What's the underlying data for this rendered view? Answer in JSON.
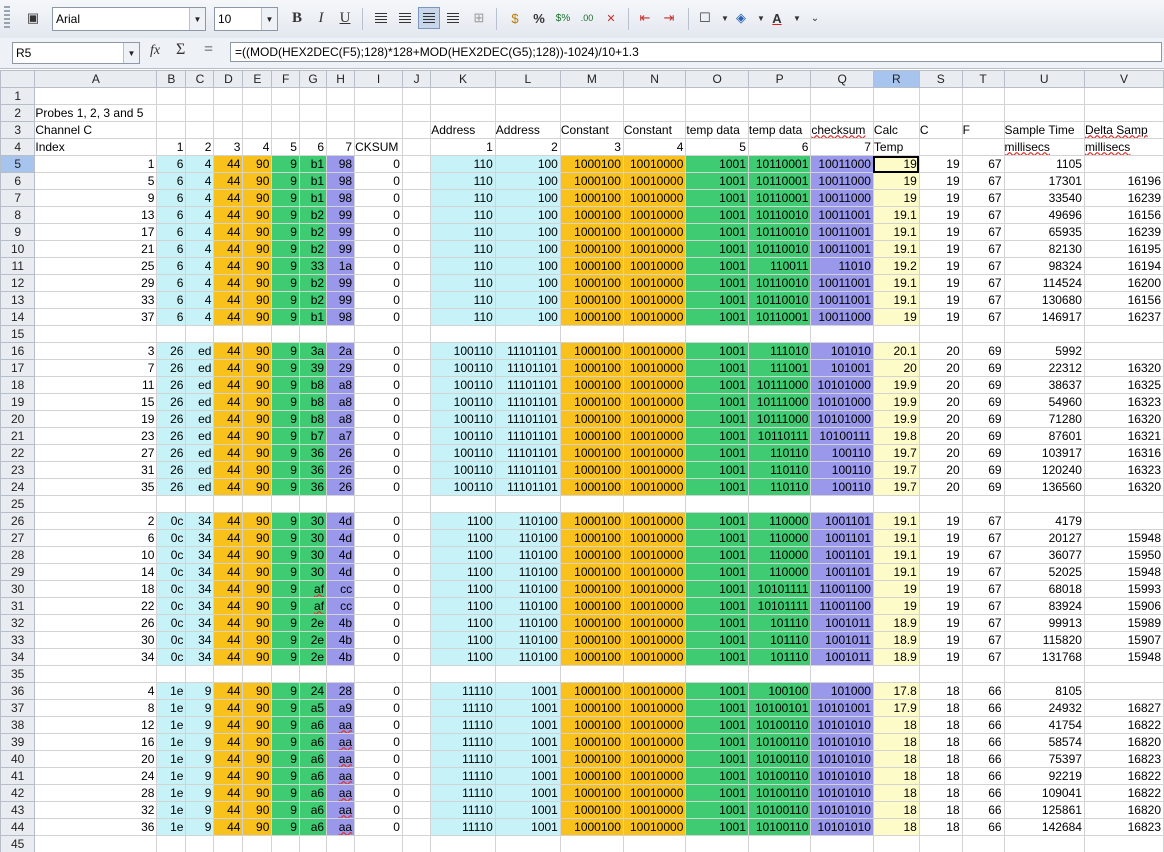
{
  "toolbar": {
    "font_name": "Arial",
    "font_size": "10",
    "bold_label": "B",
    "italic_label": "I",
    "underline_label": "U",
    "percent_label": "%"
  },
  "formula_bar": {
    "cell_ref": "R5",
    "formula": "=((MOD(HEX2DEC(F5);128)*128+MOD(HEX2DEC(G5);128))-1024)/10+1.3"
  },
  "selected": {
    "row": 5,
    "col": "R"
  },
  "colors": {
    "cyan": "#c6f2f8",
    "orange": "#f8c11b",
    "green": "#3ecb72",
    "purple": "#9a98ea",
    "yellow": "#fdfbc8"
  },
  "columns": [
    "A",
    "B",
    "C",
    "D",
    "E",
    "F",
    "G",
    "H",
    "I",
    "J",
    "K",
    "L",
    "M",
    "N",
    "O",
    "P",
    "Q",
    "R",
    "S",
    "T",
    "U",
    "V"
  ],
  "rows": [
    {
      "n": 1,
      "c": {}
    },
    {
      "n": 2,
      "c": {
        "A": "Probes 1, 2, 3 and 5"
      }
    },
    {
      "n": 3,
      "c": {
        "A": "Channel C",
        "K": "Address",
        "L": "Address",
        "M": "Constant",
        "N": "Constant",
        "O": "temp data",
        "P": "temp data",
        "Q": "checksum",
        "R": "Calc",
        "S": "C",
        "T": "F",
        "U": "Sample Time",
        "V": "Delta Samp"
      }
    },
    {
      "n": 4,
      "c": {
        "A": "Index",
        "B": "1",
        "C": "2",
        "D": "3",
        "E": "4",
        "F": "5",
        "G": "6",
        "H": "7",
        "I": "CKSUM",
        "K": "1",
        "L": "2",
        "M": "3",
        "N": "4",
        "O": "5",
        "P": "6",
        "Q": "7",
        "R": "Temp",
        "U": "millisecs",
        "V": "millisecs"
      }
    },
    {
      "n": 5,
      "c": {
        "A": "1",
        "B": "6",
        "C": "4",
        "D": "44",
        "E": "90",
        "F": "9",
        "G": "b1",
        "H": "98",
        "I": "0",
        "K": "110",
        "L": "100",
        "M": "1000100",
        "N": "10010000",
        "O": "1001",
        "P": "10110001",
        "Q": "10011000",
        "R": "19",
        "S": "19",
        "T": "67",
        "U": "1105",
        "V": ""
      }
    },
    {
      "n": 6,
      "c": {
        "A": "5",
        "B": "6",
        "C": "4",
        "D": "44",
        "E": "90",
        "F": "9",
        "G": "b1",
        "H": "98",
        "I": "0",
        "K": "110",
        "L": "100",
        "M": "1000100",
        "N": "10010000",
        "O": "1001",
        "P": "10110001",
        "Q": "10011000",
        "R": "19",
        "S": "19",
        "T": "67",
        "U": "17301",
        "V": "16196"
      }
    },
    {
      "n": 7,
      "c": {
        "A": "9",
        "B": "6",
        "C": "4",
        "D": "44",
        "E": "90",
        "F": "9",
        "G": "b1",
        "H": "98",
        "I": "0",
        "K": "110",
        "L": "100",
        "M": "1000100",
        "N": "10010000",
        "O": "1001",
        "P": "10110001",
        "Q": "10011000",
        "R": "19",
        "S": "19",
        "T": "67",
        "U": "33540",
        "V": "16239"
      }
    },
    {
      "n": 8,
      "c": {
        "A": "13",
        "B": "6",
        "C": "4",
        "D": "44",
        "E": "90",
        "F": "9",
        "G": "b2",
        "H": "99",
        "I": "0",
        "K": "110",
        "L": "100",
        "M": "1000100",
        "N": "10010000",
        "O": "1001",
        "P": "10110010",
        "Q": "10011001",
        "R": "19.1",
        "S": "19",
        "T": "67",
        "U": "49696",
        "V": "16156"
      }
    },
    {
      "n": 9,
      "c": {
        "A": "17",
        "B": "6",
        "C": "4",
        "D": "44",
        "E": "90",
        "F": "9",
        "G": "b2",
        "H": "99",
        "I": "0",
        "K": "110",
        "L": "100",
        "M": "1000100",
        "N": "10010000",
        "O": "1001",
        "P": "10110010",
        "Q": "10011001",
        "R": "19.1",
        "S": "19",
        "T": "67",
        "U": "65935",
        "V": "16239"
      }
    },
    {
      "n": 10,
      "c": {
        "A": "21",
        "B": "6",
        "C": "4",
        "D": "44",
        "E": "90",
        "F": "9",
        "G": "b2",
        "H": "99",
        "I": "0",
        "K": "110",
        "L": "100",
        "M": "1000100",
        "N": "10010000",
        "O": "1001",
        "P": "10110010",
        "Q": "10011001",
        "R": "19.1",
        "S": "19",
        "T": "67",
        "U": "82130",
        "V": "16195"
      }
    },
    {
      "n": 11,
      "c": {
        "A": "25",
        "B": "6",
        "C": "4",
        "D": "44",
        "E": "90",
        "F": "9",
        "G": "33",
        "H": "1a",
        "I": "0",
        "K": "110",
        "L": "100",
        "M": "1000100",
        "N": "10010000",
        "O": "1001",
        "P": "110011",
        "Q": "11010",
        "R": "19.2",
        "S": "19",
        "T": "67",
        "U": "98324",
        "V": "16194"
      }
    },
    {
      "n": 12,
      "c": {
        "A": "29",
        "B": "6",
        "C": "4",
        "D": "44",
        "E": "90",
        "F": "9",
        "G": "b2",
        "H": "99",
        "I": "0",
        "K": "110",
        "L": "100",
        "M": "1000100",
        "N": "10010000",
        "O": "1001",
        "P": "10110010",
        "Q": "10011001",
        "R": "19.1",
        "S": "19",
        "T": "67",
        "U": "114524",
        "V": "16200"
      }
    },
    {
      "n": 13,
      "c": {
        "A": "33",
        "B": "6",
        "C": "4",
        "D": "44",
        "E": "90",
        "F": "9",
        "G": "b2",
        "H": "99",
        "I": "0",
        "K": "110",
        "L": "100",
        "M": "1000100",
        "N": "10010000",
        "O": "1001",
        "P": "10110010",
        "Q": "10011001",
        "R": "19.1",
        "S": "19",
        "T": "67",
        "U": "130680",
        "V": "16156"
      }
    },
    {
      "n": 14,
      "c": {
        "A": "37",
        "B": "6",
        "C": "4",
        "D": "44",
        "E": "90",
        "F": "9",
        "G": "b1",
        "H": "98",
        "I": "0",
        "K": "110",
        "L": "100",
        "M": "1000100",
        "N": "10010000",
        "O": "1001",
        "P": "10110001",
        "Q": "10011000",
        "R": "19",
        "S": "19",
        "T": "67",
        "U": "146917",
        "V": "16237"
      }
    },
    {
      "n": 15,
      "c": {}
    },
    {
      "n": 16,
      "c": {
        "A": "3",
        "B": "26",
        "C": "ed",
        "D": "44",
        "E": "90",
        "F": "9",
        "G": "3a",
        "H": "2a",
        "I": "0",
        "K": "100110",
        "L": "11101101",
        "M": "1000100",
        "N": "10010000",
        "O": "1001",
        "P": "111010",
        "Q": "101010",
        "R": "20.1",
        "S": "20",
        "T": "69",
        "U": "5992",
        "V": ""
      }
    },
    {
      "n": 17,
      "c": {
        "A": "7",
        "B": "26",
        "C": "ed",
        "D": "44",
        "E": "90",
        "F": "9",
        "G": "39",
        "H": "29",
        "I": "0",
        "K": "100110",
        "L": "11101101",
        "M": "1000100",
        "N": "10010000",
        "O": "1001",
        "P": "111001",
        "Q": "101001",
        "R": "20",
        "S": "20",
        "T": "69",
        "U": "22312",
        "V": "16320"
      }
    },
    {
      "n": 18,
      "c": {
        "A": "11",
        "B": "26",
        "C": "ed",
        "D": "44",
        "E": "90",
        "F": "9",
        "G": "b8",
        "H": "a8",
        "I": "0",
        "K": "100110",
        "L": "11101101",
        "M": "1000100",
        "N": "10010000",
        "O": "1001",
        "P": "10111000",
        "Q": "10101000",
        "R": "19.9",
        "S": "20",
        "T": "69",
        "U": "38637",
        "V": "16325"
      }
    },
    {
      "n": 19,
      "c": {
        "A": "15",
        "B": "26",
        "C": "ed",
        "D": "44",
        "E": "90",
        "F": "9",
        "G": "b8",
        "H": "a8",
        "I": "0",
        "K": "100110",
        "L": "11101101",
        "M": "1000100",
        "N": "10010000",
        "O": "1001",
        "P": "10111000",
        "Q": "10101000",
        "R": "19.9",
        "S": "20",
        "T": "69",
        "U": "54960",
        "V": "16323"
      }
    },
    {
      "n": 20,
      "c": {
        "A": "19",
        "B": "26",
        "C": "ed",
        "D": "44",
        "E": "90",
        "F": "9",
        "G": "b8",
        "H": "a8",
        "I": "0",
        "K": "100110",
        "L": "11101101",
        "M": "1000100",
        "N": "10010000",
        "O": "1001",
        "P": "10111000",
        "Q": "10101000",
        "R": "19.9",
        "S": "20",
        "T": "69",
        "U": "71280",
        "V": "16320"
      }
    },
    {
      "n": 21,
      "c": {
        "A": "23",
        "B": "26",
        "C": "ed",
        "D": "44",
        "E": "90",
        "F": "9",
        "G": "b7",
        "H": "a7",
        "I": "0",
        "K": "100110",
        "L": "11101101",
        "M": "1000100",
        "N": "10010000",
        "O": "1001",
        "P": "10110111",
        "Q": "10100111",
        "R": "19.8",
        "S": "20",
        "T": "69",
        "U": "87601",
        "V": "16321"
      }
    },
    {
      "n": 22,
      "c": {
        "A": "27",
        "B": "26",
        "C": "ed",
        "D": "44",
        "E": "90",
        "F": "9",
        "G": "36",
        "H": "26",
        "I": "0",
        "K": "100110",
        "L": "11101101",
        "M": "1000100",
        "N": "10010000",
        "O": "1001",
        "P": "110110",
        "Q": "100110",
        "R": "19.7",
        "S": "20",
        "T": "69",
        "U": "103917",
        "V": "16316"
      }
    },
    {
      "n": 23,
      "c": {
        "A": "31",
        "B": "26",
        "C": "ed",
        "D": "44",
        "E": "90",
        "F": "9",
        "G": "36",
        "H": "26",
        "I": "0",
        "K": "100110",
        "L": "11101101",
        "M": "1000100",
        "N": "10010000",
        "O": "1001",
        "P": "110110",
        "Q": "100110",
        "R": "19.7",
        "S": "20",
        "T": "69",
        "U": "120240",
        "V": "16323"
      }
    },
    {
      "n": 24,
      "c": {
        "A": "35",
        "B": "26",
        "C": "ed",
        "D": "44",
        "E": "90",
        "F": "9",
        "G": "36",
        "H": "26",
        "I": "0",
        "K": "100110",
        "L": "11101101",
        "M": "1000100",
        "N": "10010000",
        "O": "1001",
        "P": "110110",
        "Q": "100110",
        "R": "19.7",
        "S": "20",
        "T": "69",
        "U": "136560",
        "V": "16320"
      }
    },
    {
      "n": 25,
      "c": {}
    },
    {
      "n": 26,
      "c": {
        "A": "2",
        "B": "0c",
        "C": "34",
        "D": "44",
        "E": "90",
        "F": "9",
        "G": "30",
        "H": "4d",
        "I": "0",
        "K": "1100",
        "L": "110100",
        "M": "1000100",
        "N": "10010000",
        "O": "1001",
        "P": "110000",
        "Q": "1001101",
        "R": "19.1",
        "S": "19",
        "T": "67",
        "U": "4179",
        "V": ""
      }
    },
    {
      "n": 27,
      "c": {
        "A": "6",
        "B": "0c",
        "C": "34",
        "D": "44",
        "E": "90",
        "F": "9",
        "G": "30",
        "H": "4d",
        "I": "0",
        "K": "1100",
        "L": "110100",
        "M": "1000100",
        "N": "10010000",
        "O": "1001",
        "P": "110000",
        "Q": "1001101",
        "R": "19.1",
        "S": "19",
        "T": "67",
        "U": "20127",
        "V": "15948"
      }
    },
    {
      "n": 28,
      "c": {
        "A": "10",
        "B": "0c",
        "C": "34",
        "D": "44",
        "E": "90",
        "F": "9",
        "G": "30",
        "H": "4d",
        "I": "0",
        "K": "1100",
        "L": "110100",
        "M": "1000100",
        "N": "10010000",
        "O": "1001",
        "P": "110000",
        "Q": "1001101",
        "R": "19.1",
        "S": "19",
        "T": "67",
        "U": "36077",
        "V": "15950"
      }
    },
    {
      "n": 29,
      "c": {
        "A": "14",
        "B": "0c",
        "C": "34",
        "D": "44",
        "E": "90",
        "F": "9",
        "G": "30",
        "H": "4d",
        "I": "0",
        "K": "1100",
        "L": "110100",
        "M": "1000100",
        "N": "10010000",
        "O": "1001",
        "P": "110000",
        "Q": "1001101",
        "R": "19.1",
        "S": "19",
        "T": "67",
        "U": "52025",
        "V": "15948"
      }
    },
    {
      "n": 30,
      "c": {
        "A": "18",
        "B": "0c",
        "C": "34",
        "D": "44",
        "E": "90",
        "F": "9",
        "G": "af",
        "H": "cc",
        "I": "0",
        "K": "1100",
        "L": "110100",
        "M": "1000100",
        "N": "10010000",
        "O": "1001",
        "P": "10101111",
        "Q": "11001100",
        "R": "19",
        "S": "19",
        "T": "67",
        "U": "68018",
        "V": "15993"
      }
    },
    {
      "n": 31,
      "c": {
        "A": "22",
        "B": "0c",
        "C": "34",
        "D": "44",
        "E": "90",
        "F": "9",
        "G": "af",
        "H": "cc",
        "I": "0",
        "K": "1100",
        "L": "110100",
        "M": "1000100",
        "N": "10010000",
        "O": "1001",
        "P": "10101111",
        "Q": "11001100",
        "R": "19",
        "S": "19",
        "T": "67",
        "U": "83924",
        "V": "15906"
      }
    },
    {
      "n": 32,
      "c": {
        "A": "26",
        "B": "0c",
        "C": "34",
        "D": "44",
        "E": "90",
        "F": "9",
        "G": "2e",
        "H": "4b",
        "I": "0",
        "K": "1100",
        "L": "110100",
        "M": "1000100",
        "N": "10010000",
        "O": "1001",
        "P": "101110",
        "Q": "1001011",
        "R": "18.9",
        "S": "19",
        "T": "67",
        "U": "99913",
        "V": "15989"
      }
    },
    {
      "n": 33,
      "c": {
        "A": "30",
        "B": "0c",
        "C": "34",
        "D": "44",
        "E": "90",
        "F": "9",
        "G": "2e",
        "H": "4b",
        "I": "0",
        "K": "1100",
        "L": "110100",
        "M": "1000100",
        "N": "10010000",
        "O": "1001",
        "P": "101110",
        "Q": "1001011",
        "R": "18.9",
        "S": "19",
        "T": "67",
        "U": "115820",
        "V": "15907"
      }
    },
    {
      "n": 34,
      "c": {
        "A": "34",
        "B": "0c",
        "C": "34",
        "D": "44",
        "E": "90",
        "F": "9",
        "G": "2e",
        "H": "4b",
        "I": "0",
        "K": "1100",
        "L": "110100",
        "M": "1000100",
        "N": "10010000",
        "O": "1001",
        "P": "101110",
        "Q": "1001011",
        "R": "18.9",
        "S": "19",
        "T": "67",
        "U": "131768",
        "V": "15948"
      }
    },
    {
      "n": 35,
      "c": {}
    },
    {
      "n": 36,
      "c": {
        "A": "4",
        "B": "1e",
        "C": "9",
        "D": "44",
        "E": "90",
        "F": "9",
        "G": "24",
        "H": "28",
        "I": "0",
        "K": "11110",
        "L": "1001",
        "M": "1000100",
        "N": "10010000",
        "O": "1001",
        "P": "100100",
        "Q": "101000",
        "R": "17.8",
        "S": "18",
        "T": "66",
        "U": "8105",
        "V": ""
      }
    },
    {
      "n": 37,
      "c": {
        "A": "8",
        "B": "1e",
        "C": "9",
        "D": "44",
        "E": "90",
        "F": "9",
        "G": "a5",
        "H": "a9",
        "I": "0",
        "K": "11110",
        "L": "1001",
        "M": "1000100",
        "N": "10010000",
        "O": "1001",
        "P": "10100101",
        "Q": "10101001",
        "R": "17.9",
        "S": "18",
        "T": "66",
        "U": "24932",
        "V": "16827"
      }
    },
    {
      "n": 38,
      "c": {
        "A": "12",
        "B": "1e",
        "C": "9",
        "D": "44",
        "E": "90",
        "F": "9",
        "G": "a6",
        "H": "aa",
        "I": "0",
        "K": "11110",
        "L": "1001",
        "M": "1000100",
        "N": "10010000",
        "O": "1001",
        "P": "10100110",
        "Q": "10101010",
        "R": "18",
        "S": "18",
        "T": "66",
        "U": "41754",
        "V": "16822"
      }
    },
    {
      "n": 39,
      "c": {
        "A": "16",
        "B": "1e",
        "C": "9",
        "D": "44",
        "E": "90",
        "F": "9",
        "G": "a6",
        "H": "aa",
        "I": "0",
        "K": "11110",
        "L": "1001",
        "M": "1000100",
        "N": "10010000",
        "O": "1001",
        "P": "10100110",
        "Q": "10101010",
        "R": "18",
        "S": "18",
        "T": "66",
        "U": "58574",
        "V": "16820"
      }
    },
    {
      "n": 40,
      "c": {
        "A": "20",
        "B": "1e",
        "C": "9",
        "D": "44",
        "E": "90",
        "F": "9",
        "G": "a6",
        "H": "aa",
        "I": "0",
        "K": "11110",
        "L": "1001",
        "M": "1000100",
        "N": "10010000",
        "O": "1001",
        "P": "10100110",
        "Q": "10101010",
        "R": "18",
        "S": "18",
        "T": "66",
        "U": "75397",
        "V": "16823"
      }
    },
    {
      "n": 41,
      "c": {
        "A": "24",
        "B": "1e",
        "C": "9",
        "D": "44",
        "E": "90",
        "F": "9",
        "G": "a6",
        "H": "aa",
        "I": "0",
        "K": "11110",
        "L": "1001",
        "M": "1000100",
        "N": "10010000",
        "O": "1001",
        "P": "10100110",
        "Q": "10101010",
        "R": "18",
        "S": "18",
        "T": "66",
        "U": "92219",
        "V": "16822"
      }
    },
    {
      "n": 42,
      "c": {
        "A": "28",
        "B": "1e",
        "C": "9",
        "D": "44",
        "E": "90",
        "F": "9",
        "G": "a6",
        "H": "aa",
        "I": "0",
        "K": "11110",
        "L": "1001",
        "M": "1000100",
        "N": "10010000",
        "O": "1001",
        "P": "10100110",
        "Q": "10101010",
        "R": "18",
        "S": "18",
        "T": "66",
        "U": "109041",
        "V": "16822"
      }
    },
    {
      "n": 43,
      "c": {
        "A": "32",
        "B": "1e",
        "C": "9",
        "D": "44",
        "E": "90",
        "F": "9",
        "G": "a6",
        "H": "aa",
        "I": "0",
        "K": "11110",
        "L": "1001",
        "M": "1000100",
        "N": "10010000",
        "O": "1001",
        "P": "10100110",
        "Q": "10101010",
        "R": "18",
        "S": "18",
        "T": "66",
        "U": "125861",
        "V": "16820"
      }
    },
    {
      "n": 44,
      "c": {
        "A": "36",
        "B": "1e",
        "C": "9",
        "D": "44",
        "E": "90",
        "F": "9",
        "G": "a6",
        "H": "aa",
        "I": "0",
        "K": "11110",
        "L": "1001",
        "M": "1000100",
        "N": "10010000",
        "O": "1001",
        "P": "10100110",
        "Q": "10101010",
        "R": "18",
        "S": "18",
        "T": "66",
        "U": "142684",
        "V": "16823"
      }
    },
    {
      "n": 45,
      "c": {}
    }
  ]
}
